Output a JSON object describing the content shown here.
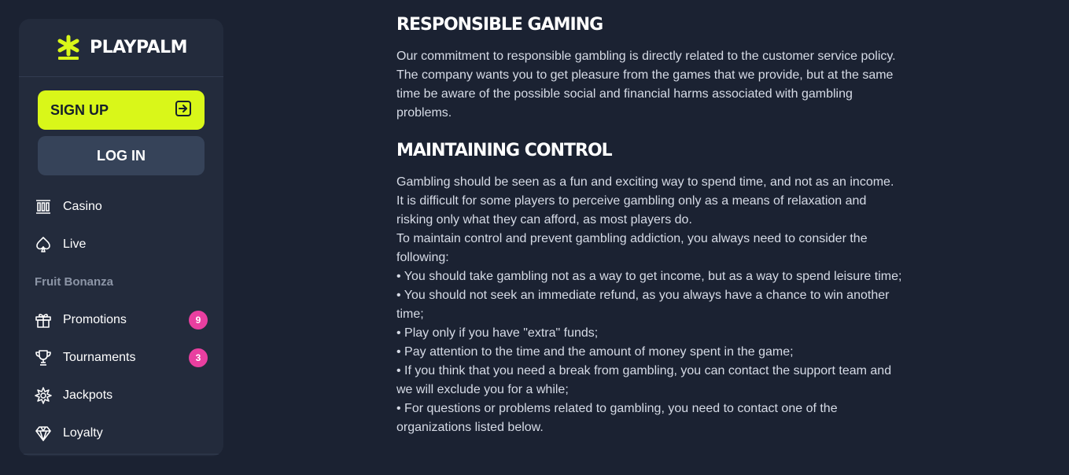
{
  "brand": {
    "name": "PLAYPALM",
    "logo_icon": "asterisk-star-icon",
    "accent": "#d9f719"
  },
  "auth": {
    "signup_label": "SIGN UP",
    "signup_icon": "enter-arrow-icon",
    "login_label": "LOG IN"
  },
  "nav": {
    "items": [
      {
        "label": "Casino",
        "icon": "columns-icon"
      },
      {
        "label": "Live",
        "icon": "spade-icon"
      }
    ],
    "section_label": "Fruit Bonanza",
    "items2": [
      {
        "label": "Promotions",
        "icon": "gift-icon",
        "badge": "9"
      },
      {
        "label": "Tournaments",
        "icon": "trophy-icon",
        "badge": "3"
      },
      {
        "label": "Jackpots",
        "icon": "starburst-icon"
      },
      {
        "label": "Loyalty",
        "icon": "diamond-icon"
      }
    ]
  },
  "content": {
    "section1": {
      "title": "RESPONSIBLE GAMING",
      "body": "Our commitment to responsible gambling is directly related to the customer service policy. The company wants you to get pleasure from the games that we provide, but at the same time be aware of the possible social and financial harms associated with gambling problems."
    },
    "section2": {
      "title": "MAINTAINING CONTROL",
      "lines": [
        "Gambling should be seen as a fun and exciting way to spend time, and not as an income. It is difficult for some players to perceive gambling only as a means of relaxation and risking only what they can afford, as most players do.",
        "To maintain control and prevent gambling addiction, you always need to consider the following:",
        "• You should take gambling not as a way to get income, but as a way to spend leisure time;",
        "• You should not seek an immediate refund, as you always have a chance to win another time;",
        "• Play only if you have \"extra\" funds;",
        "• Pay attention to the time and the amount of money spent in the game;",
        "• If you think that you need a break from gambling, you can contact the support team and we will exclude you for a while;",
        "• For questions or problems related to gambling, you need to contact one of the organizations listed below."
      ]
    }
  }
}
